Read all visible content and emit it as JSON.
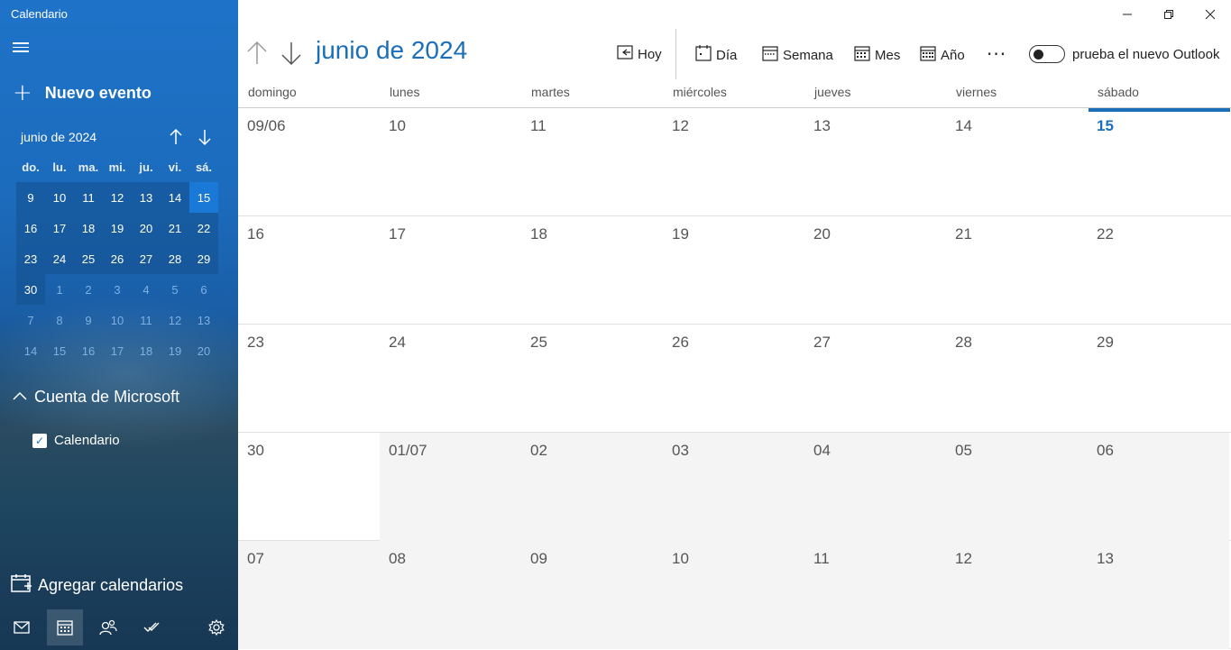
{
  "app": {
    "title": "Calendario"
  },
  "sidebar": {
    "new_event": "Nuevo evento",
    "mini_month": "junio de 2024",
    "dow": [
      "do.",
      "lu.",
      "ma.",
      "mi.",
      "ju.",
      "vi.",
      "sá."
    ],
    "weeks": [
      [
        "9",
        "10",
        "11",
        "12",
        "13",
        "14",
        "15"
      ],
      [
        "16",
        "17",
        "18",
        "19",
        "20",
        "21",
        "22"
      ],
      [
        "23",
        "24",
        "25",
        "26",
        "27",
        "28",
        "29"
      ],
      [
        "30",
        "1",
        "2",
        "3",
        "4",
        "5",
        "6"
      ],
      [
        "7",
        "8",
        "9",
        "10",
        "11",
        "12",
        "13"
      ],
      [
        "14",
        "15",
        "16",
        "17",
        "18",
        "19",
        "20"
      ]
    ],
    "account": "Cuenta de Microsoft",
    "calendar_item": "Calendario",
    "add_calendars": "Agregar calendarios"
  },
  "header": {
    "month_title": "junio de 2024",
    "today": "Hoy",
    "day": "Día",
    "week": "Semana",
    "month": "Mes",
    "year": "Año",
    "more": "···",
    "toggle_label": "prueba el nuevo Outlook"
  },
  "grid": {
    "dow": [
      "domingo",
      "lunes",
      "martes",
      "miércoles",
      "jueves",
      "viernes",
      "sábado"
    ],
    "weeks": [
      [
        "09/06",
        "10",
        "11",
        "12",
        "13",
        "14",
        "15"
      ],
      [
        "16",
        "17",
        "18",
        "19",
        "20",
        "21",
        "22"
      ],
      [
        "23",
        "24",
        "25",
        "26",
        "27",
        "28",
        "29"
      ],
      [
        "30",
        "01/07",
        "02",
        "03",
        "04",
        "05",
        "06"
      ],
      [
        "07",
        "08",
        "09",
        "10",
        "11",
        "12",
        "13"
      ]
    ]
  },
  "colors": {
    "accent": "#1a6fb8",
    "selected": "#1a78d6"
  }
}
